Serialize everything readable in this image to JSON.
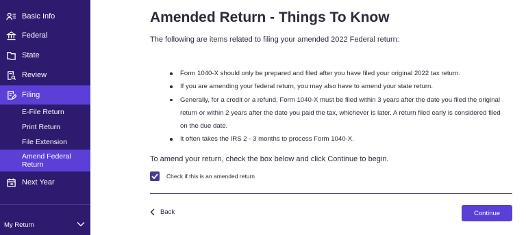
{
  "sidebar": {
    "items": [
      {
        "label": "Basic Info",
        "icon": "person-list-icon"
      },
      {
        "label": "Federal",
        "icon": "capitol-icon"
      },
      {
        "label": "State",
        "icon": "map-icon"
      },
      {
        "label": "Review",
        "icon": "document-search-icon"
      },
      {
        "label": "Filing",
        "icon": "document-edit-icon"
      }
    ],
    "sub_items": [
      {
        "label": "E-File Return"
      },
      {
        "label": "Print Return"
      },
      {
        "label": "File Extension"
      },
      {
        "label": "Amend Federal Return"
      }
    ],
    "next_year": {
      "label": "Next Year",
      "icon": "calendar-icon"
    },
    "my_return": {
      "label": "My Return"
    }
  },
  "main": {
    "title": "Amended Return - Things To Know",
    "intro": "The following are items related to filing your amended 2022 Federal return:",
    "bullets": [
      "Form 1040-X should only be prepared and filed after you have filed your original 2022 tax return.",
      "If you are amending your federal return, you may also have to amend your state return.",
      "Generally, for a credit or a refund, Form 1040-X must be filed within 3 years after the date you filed the original return or within 2 years after the date you paid the tax, whichever is later. A return filed early is considered filed on the due date.",
      "It often takes the IRS 2 - 3 months to process Form 1040-X."
    ],
    "instruction": "To amend your return, check the box below and click Continue to begin.",
    "checkbox_label": "Check if this is an amended return",
    "checkbox_checked": true,
    "back_label": "Back",
    "continue_label": "Continue"
  },
  "colors": {
    "sidebar_bg": "#2e1a6e",
    "accent": "#5b3fd6",
    "text": "#2b2b3a"
  }
}
